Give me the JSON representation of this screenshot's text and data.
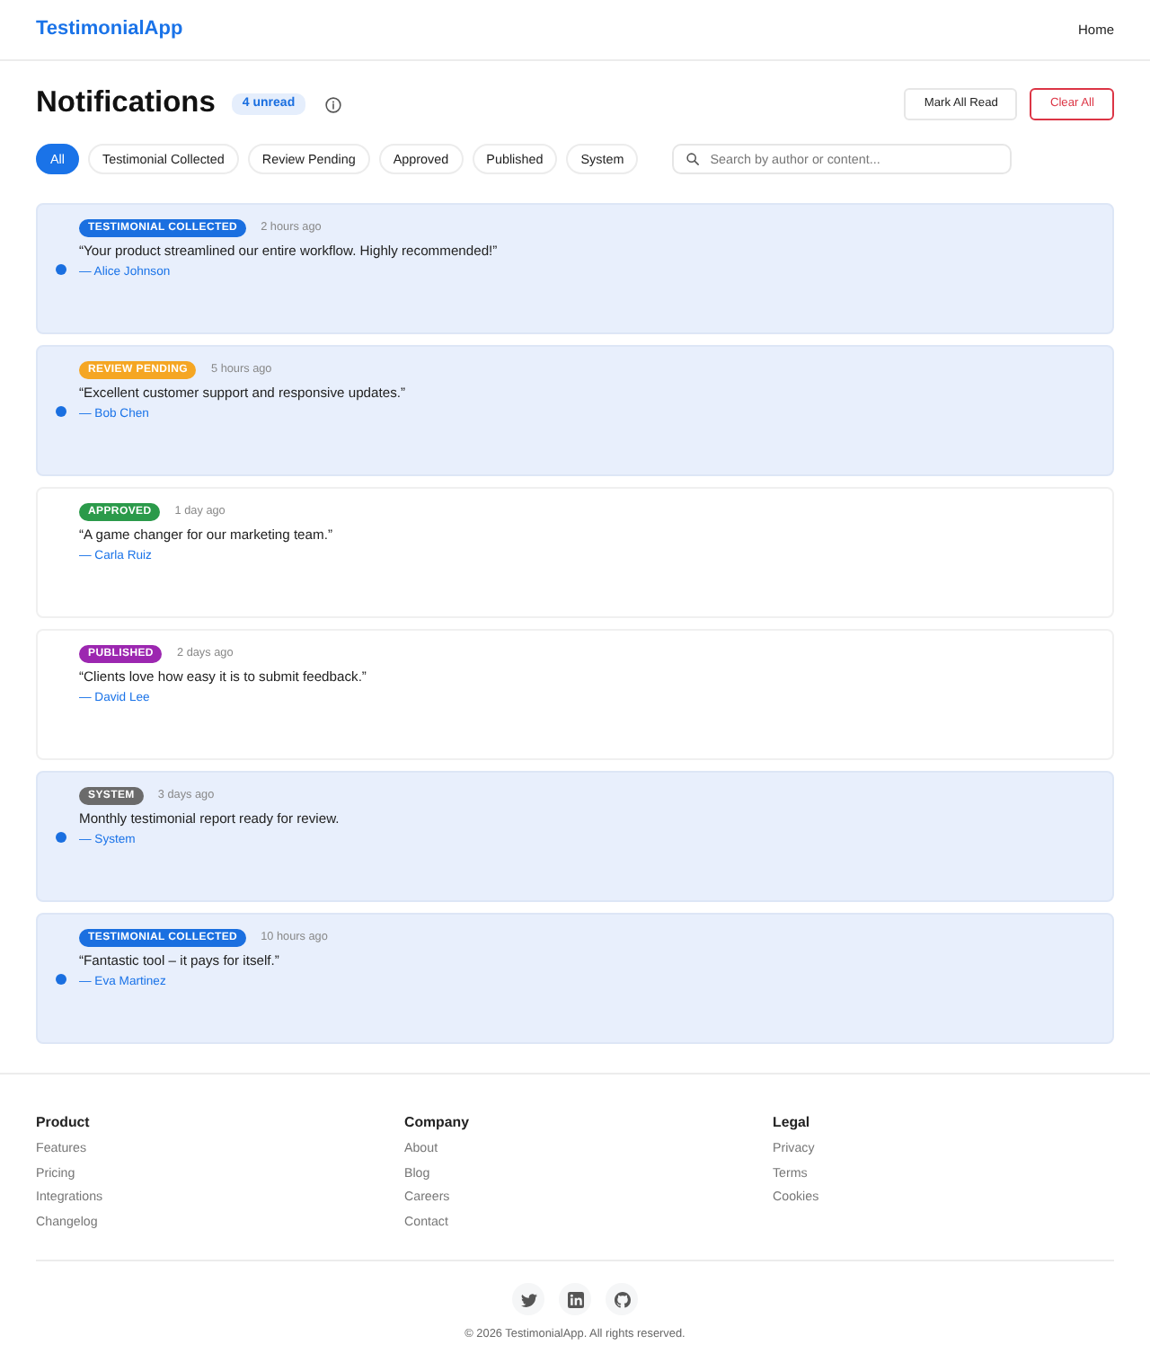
{
  "navbar": {
    "brand": "TestimonialApp",
    "links": [
      {
        "label": "Home"
      }
    ]
  },
  "header": {
    "title": "Notifications",
    "unread_badge": "4 unread",
    "actions": [
      {
        "label": "Mark All Read",
        "kind": "neutral"
      },
      {
        "label": "Clear All",
        "kind": "danger"
      }
    ]
  },
  "filters": [
    {
      "label": "All",
      "selected": true
    },
    {
      "label": "Testimonial Collected",
      "selected": false
    },
    {
      "label": "Review Pending",
      "selected": false
    },
    {
      "label": "Approved",
      "selected": false
    },
    {
      "label": "Published",
      "selected": false
    },
    {
      "label": "System",
      "selected": false
    }
  ],
  "search": {
    "placeholder": "Search by author or content..."
  },
  "notifications": [
    {
      "category": "TESTIMONIAL COLLECTED",
      "color": "#1a6fe0",
      "time": "2 hours ago",
      "text": "“Your product streamlined our entire workflow. Highly recommended!”",
      "author": "— Alice Johnson",
      "unread": true
    },
    {
      "category": "REVIEW PENDING",
      "color": "#f5a623",
      "time": "5 hours ago",
      "text": "“Excellent customer support and responsive updates.”",
      "author": "— Bob Chen",
      "unread": true
    },
    {
      "category": "APPROVED",
      "color": "#2b9a4a",
      "time": "1 day ago",
      "text": "“A game changer for our marketing team.”",
      "author": "— Carla Ruiz",
      "unread": false
    },
    {
      "category": "PUBLISHED",
      "color": "#9c27b0",
      "time": "2 days ago",
      "text": "“Clients love how easy it is to submit feedback.”",
      "author": "— David Lee",
      "unread": false
    },
    {
      "category": "SYSTEM",
      "color": "#6b6b6b",
      "time": "3 days ago",
      "text": "Monthly testimonial report ready for review.",
      "author": "— System",
      "unread": true
    },
    {
      "category": "TESTIMONIAL COLLECTED",
      "color": "#1a6fe0",
      "time": "10 hours ago",
      "text": "“Fantastic tool – it pays for itself.”",
      "author": "— Eva Martinez",
      "unread": true
    }
  ],
  "footer": {
    "columns": [
      {
        "heading": "Product",
        "links": [
          "Features",
          "Pricing",
          "Integrations",
          "Changelog"
        ]
      },
      {
        "heading": "Company",
        "links": [
          "About",
          "Blog",
          "Careers",
          "Contact"
        ]
      },
      {
        "heading": "Legal",
        "links": [
          "Privacy",
          "Terms",
          "Cookies"
        ]
      }
    ],
    "copyright": "© 2026 TestimonialApp. All rights reserved."
  }
}
